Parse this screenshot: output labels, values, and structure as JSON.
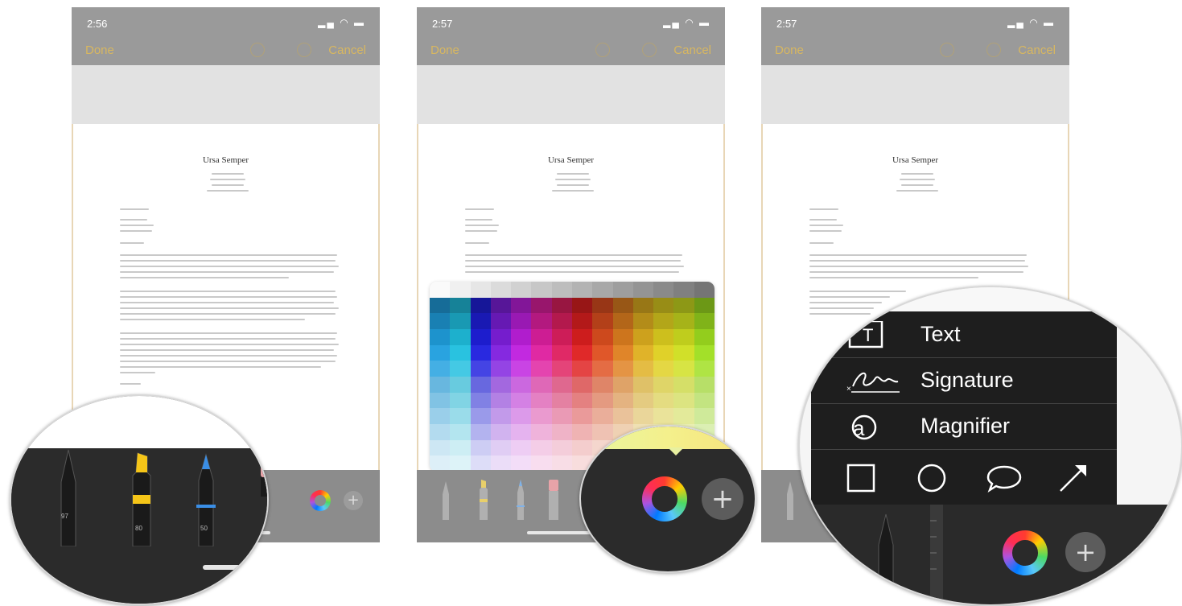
{
  "screens": [
    {
      "time": "2:56",
      "done": "Done",
      "cancel": "Cancel"
    },
    {
      "time": "2:57",
      "done": "Done",
      "cancel": "Cancel"
    },
    {
      "time": "2:57",
      "done": "Done",
      "cancel": "Cancel"
    }
  ],
  "document": {
    "name": "Ursa Semper"
  },
  "tools": {
    "pens": [
      {
        "name": "pen",
        "value": "97",
        "color": "#1a1a1a"
      },
      {
        "name": "marker",
        "value": "80",
        "color": "#f5c518"
      },
      {
        "name": "pencil",
        "value": "50",
        "color": "#3a8ee6"
      }
    ],
    "plus_symbol": "+"
  },
  "markup_menu": {
    "items": [
      {
        "label": "Text",
        "icon": "text-box-icon"
      },
      {
        "label": "Signature",
        "icon": "signature-icon"
      },
      {
        "label": "Magnifier",
        "icon": "magnifier-icon"
      }
    ],
    "shapes": [
      "square-icon",
      "circle-icon",
      "speech-bubble-icon",
      "arrow-icon"
    ]
  },
  "colors": {
    "accent": "#d8b760",
    "toolbar": "#8c8c8c",
    "menu_bg": "#1e1e1e"
  }
}
